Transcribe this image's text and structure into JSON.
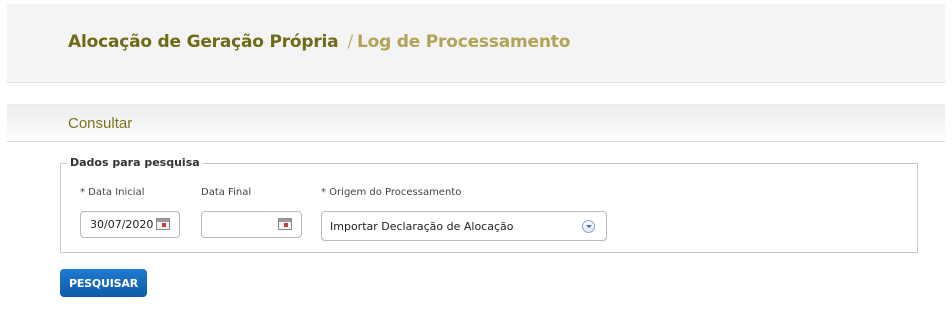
{
  "breadcrumb": {
    "primary": "Alocação de Geração Própria",
    "separator": "/",
    "secondary": "Log de Processamento"
  },
  "section": {
    "title": "Consultar"
  },
  "search_form": {
    "legend": "Dados para pesquisa",
    "start_date": {
      "label": "* Data Inicial",
      "value": "30/07/2020",
      "icon": "calendar-icon"
    },
    "end_date": {
      "label": "Data Final",
      "value": "",
      "icon": "calendar-icon"
    },
    "origin": {
      "label": "* Origem do Processamento",
      "selected": "Importar Declaração de Alocação",
      "icon": "chevron-down-circle-icon"
    }
  },
  "actions": {
    "search_label": "PESQUISAR"
  },
  "colors": {
    "brand_primary": "#6e6a16",
    "brand_secondary": "#b1a357",
    "button": "#1a6ec2"
  }
}
